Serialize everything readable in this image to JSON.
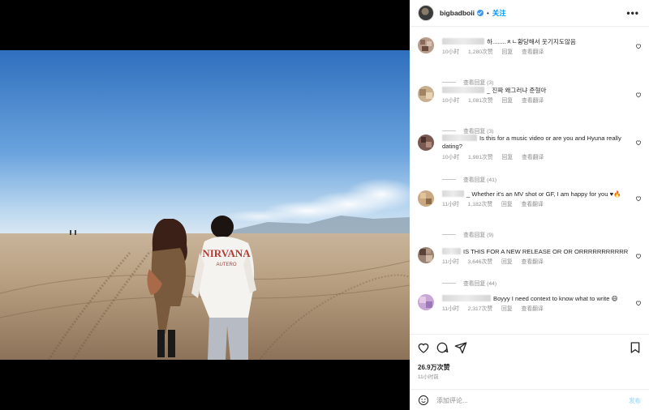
{
  "post": {
    "username": "bigbadboii",
    "separator": "•",
    "follow_label": "关注",
    "more_label": "•••",
    "likes": "26.9万次赞",
    "time_ago": "11小时前",
    "add_comment_placeholder": "添加评论...",
    "post_label": "发布"
  },
  "comments": [
    {
      "text": "하........ㅊㄴ황당해서 웃기지도않음",
      "time": "10小时",
      "likes": "1,280次赞",
      "reply": "回复",
      "translate": "查看翻译",
      "view_replies": "查看回复 (3)"
    },
    {
      "text": "_ 진짜 왜그러냐 준형아",
      "time": "10小时",
      "likes": "1,081次赞",
      "reply": "回复",
      "translate": "查看翻译",
      "view_replies": "查看回复 (3)"
    },
    {
      "text": "Is this for a music video or are you and Hyuna really dating?",
      "time": "10小时",
      "likes": "1,981次赞",
      "reply": "回复",
      "translate": "查看翻译",
      "view_replies": "查看回复 (41)"
    },
    {
      "text": "_ Whether it's an MV shot or GF, I am happy for you ♥🔥",
      "time": "11小时",
      "likes": "1,182次赞",
      "reply": "回复",
      "translate": "查看翻译",
      "view_replies": "查看回复 (9)"
    },
    {
      "text": "IS THIS FOR A NEW RELEASE OR OR ORRRRRRRRRRR",
      "time": "11小时",
      "likes": "3,646次赞",
      "reply": "回复",
      "translate": "查看翻译",
      "view_replies": "查看回复 (44)"
    },
    {
      "text": "Boyyy I need context to know what to write 😄",
      "time": "11小时",
      "likes": "2,317次赞",
      "reply": "回复",
      "translate": "查看翻译",
      "view_replies": ""
    }
  ],
  "photo": {
    "shirt_text": "NIRVANA",
    "shirt_subtext": "AUTERO"
  },
  "colors": {
    "link": "#0095f6",
    "muted": "#8e8e8e",
    "text": "#262626",
    "verified": "#3897f0"
  },
  "icons": [
    "heart-icon",
    "comment-icon",
    "share-icon",
    "bookmark-icon",
    "emoji-icon",
    "verified-badge-icon",
    "more-options-icon"
  ]
}
